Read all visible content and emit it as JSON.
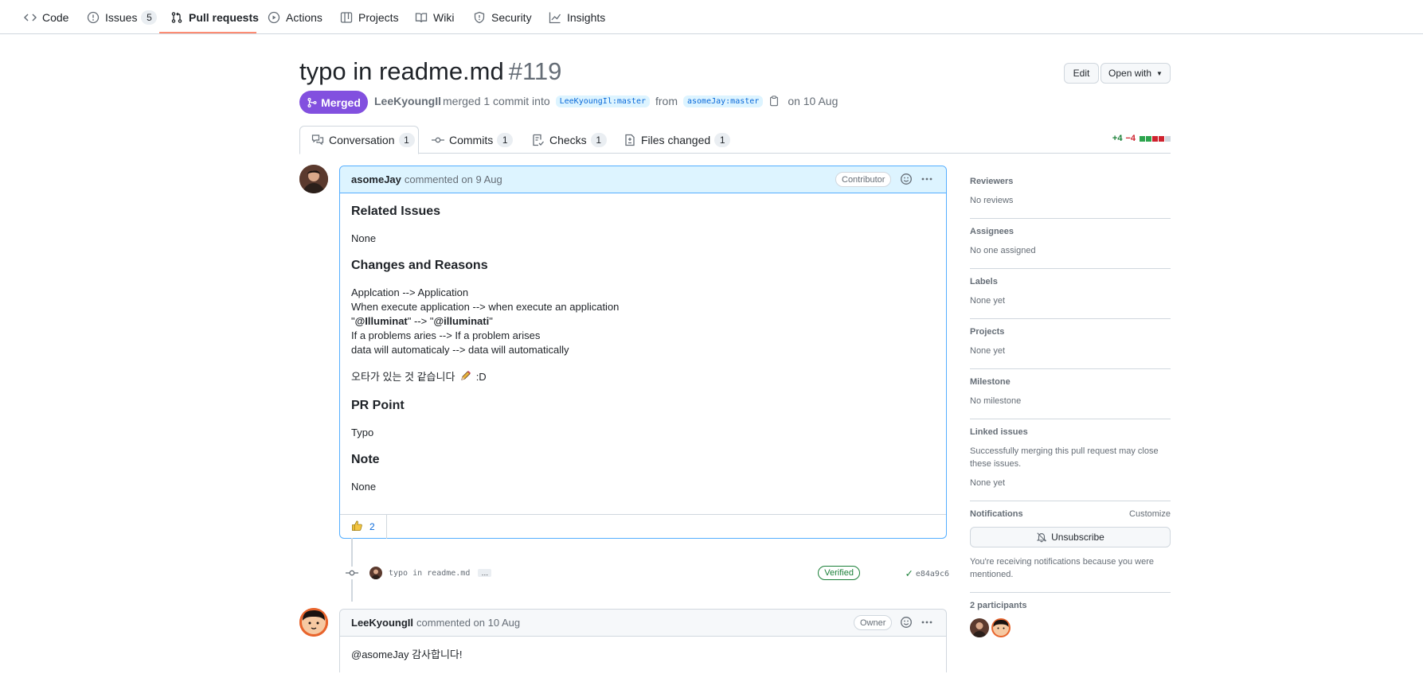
{
  "repo_nav": {
    "tabs": [
      {
        "label": "Code",
        "icon": "code-icon"
      },
      {
        "label": "Issues",
        "icon": "issue-opened-icon",
        "count": "5"
      },
      {
        "label": "Pull requests",
        "icon": "git-pull-request-icon"
      },
      {
        "label": "Actions",
        "icon": "play-icon"
      },
      {
        "label": "Projects",
        "icon": "table-icon"
      },
      {
        "label": "Wiki",
        "icon": "book-icon"
      },
      {
        "label": "Security",
        "icon": "shield-icon"
      },
      {
        "label": "Insights",
        "icon": "graph-icon"
      }
    ],
    "active_tab": "Pull requests",
    "accent_color": "#fd8c73"
  },
  "header": {
    "title": "typo in readme.md",
    "number": "#119",
    "edit_label": "Edit",
    "open_with_label": "Open with",
    "state": "Merged",
    "state_color": "#8250df",
    "author": "LeeKyoungIl",
    "merged_text": "merged 1 commit into",
    "base_branch": "LeeKyoungIl:master",
    "from_text": "from",
    "head_branch": "asomeJay:master",
    "date_text": "on 10 Aug"
  },
  "pr_tabs": [
    {
      "label": "Conversation",
      "count": "1",
      "icon": "comment-discussion-icon"
    },
    {
      "label": "Commits",
      "count": "1",
      "icon": "git-commit-icon"
    },
    {
      "label": "Checks",
      "count": "1",
      "icon": "checklist-icon"
    },
    {
      "label": "Files changed",
      "count": "1",
      "icon": "file-diff-icon"
    }
  ],
  "diffstat": {
    "additions": "+4",
    "deletions": "−4"
  },
  "comment1": {
    "author": "asomeJay",
    "meta": "commented on 9 Aug",
    "role": "Contributor",
    "h_related": "Related Issues",
    "related": "None",
    "h_changes": "Changes and Reasons",
    "changes": [
      "Applcation --> Application",
      "When execute application --> when execute an application",
      "If a problems aries --> If a problem arises",
      "data will automaticaly --> data will automatically"
    ],
    "mention_line": {
      "q1": "\"",
      "m1": "@Illuminat",
      "mid": "\" --> \"",
      "m2": "@illuminati",
      "q2": "\""
    },
    "korean_note": "오타가 있는 것 같습니다",
    "korean_suffix": ":D",
    "h_point": "PR Point",
    "point": "Typo",
    "h_note": "Note",
    "note": "None",
    "reaction_count": "2"
  },
  "commit": {
    "message": "typo in readme.md",
    "ellipsis": "…",
    "verified": "Verified",
    "sha": "e84a9c6"
  },
  "comment2": {
    "author": "LeeKyoungIl",
    "meta": "commented on 10 Aug",
    "role": "Owner",
    "mention": "@asomeJay",
    "body": "감사합니다!"
  },
  "sidebar": {
    "reviewers_title": "Reviewers",
    "reviewers_val": "No reviews",
    "assignees_title": "Assignees",
    "assignees_val": "No one assigned",
    "labels_title": "Labels",
    "labels_val": "None yet",
    "projects_title": "Projects",
    "projects_val": "None yet",
    "milestone_title": "Milestone",
    "milestone_val": "No milestone",
    "linked_title": "Linked issues",
    "linked_desc": "Successfully merging this pull request may close these issues.",
    "linked_val": "None yet",
    "notifications_title": "Notifications",
    "customize": "Customize",
    "unsubscribe": "Unsubscribe",
    "notif_reason": "You're receiving notifications because you were mentioned.",
    "participants_title": "2 participants"
  }
}
